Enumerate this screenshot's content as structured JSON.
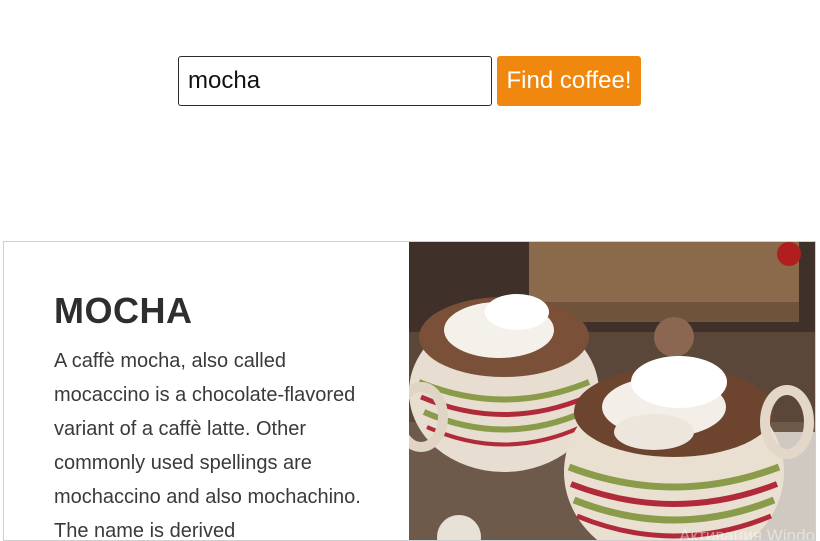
{
  "search": {
    "value": "mocha",
    "button_label": "Find coffee!"
  },
  "card": {
    "title": "MOCHA",
    "description": "A caffè mocha, also called mocaccino is a chocolate-flavored variant of a caffè latte. Other commonly used spellings are mochaccino and also mochachino. The name is derived",
    "image": "mocha-cups-photo"
  },
  "overlay": {
    "watermark": "Активация Windo"
  },
  "colors": {
    "accent": "#f0880f"
  }
}
